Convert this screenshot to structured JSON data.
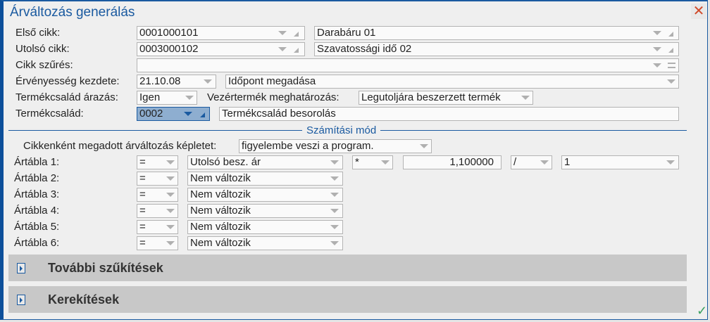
{
  "window": {
    "title": "Árváltozás generálás",
    "close_icon": "close-icon",
    "ok_icon": "check-icon"
  },
  "fields": {
    "first_item": {
      "label": "Első cikk:",
      "code": "0001000101",
      "name": "Darabáru 01"
    },
    "last_item": {
      "label": "Utolsó cikk:",
      "code": "0003000102",
      "name": "Szavatossági idő 02"
    },
    "item_filter": {
      "label": "Cikk szűrés:",
      "value": ""
    },
    "validity_start": {
      "label": "Érvényesség kezdete:",
      "date": "21.10.08",
      "mode": "Időpont megadása"
    },
    "family_pricing": {
      "label": "Termékcsalád árazás:",
      "value": "Igen",
      "leader_label": "Vezértermék meghatározás:",
      "leader_value": "Legutoljára beszerzett termék"
    },
    "product_family": {
      "label": "Termékcsalád:",
      "code": "0002",
      "name": "Termékcsalád besorolás"
    }
  },
  "calc": {
    "section_title": "Számítási mód",
    "formula_label": "Cikkenként megadott árváltozás képletet:",
    "formula_value": "figyelembe veszi a program.",
    "tables": [
      {
        "label": "Ártábla 1:",
        "op": "=",
        "value": "Utolsó besz. ár",
        "mult_op": "*",
        "factor": "1,100000",
        "div_op": "/",
        "divisor": "1"
      },
      {
        "label": "Ártábla 2:",
        "op": "=",
        "value": "Nem változik"
      },
      {
        "label": "Ártábla 3:",
        "op": "=",
        "value": "Nem változik"
      },
      {
        "label": "Ártábla 4:",
        "op": "=",
        "value": "Nem változik"
      },
      {
        "label": "Ártábla 5:",
        "op": "=",
        "value": "Nem változik"
      },
      {
        "label": "Ártábla 6:",
        "op": "=",
        "value": "Nem változik"
      }
    ]
  },
  "panels": [
    {
      "label": "További szűkítések",
      "expanded": false
    },
    {
      "label": "Kerekítések",
      "expanded": false
    }
  ],
  "colors": {
    "accent": "#1a5aa0",
    "close": "#d04a2a",
    "ok": "#3aa060",
    "panel": "#c8c8c8"
  }
}
